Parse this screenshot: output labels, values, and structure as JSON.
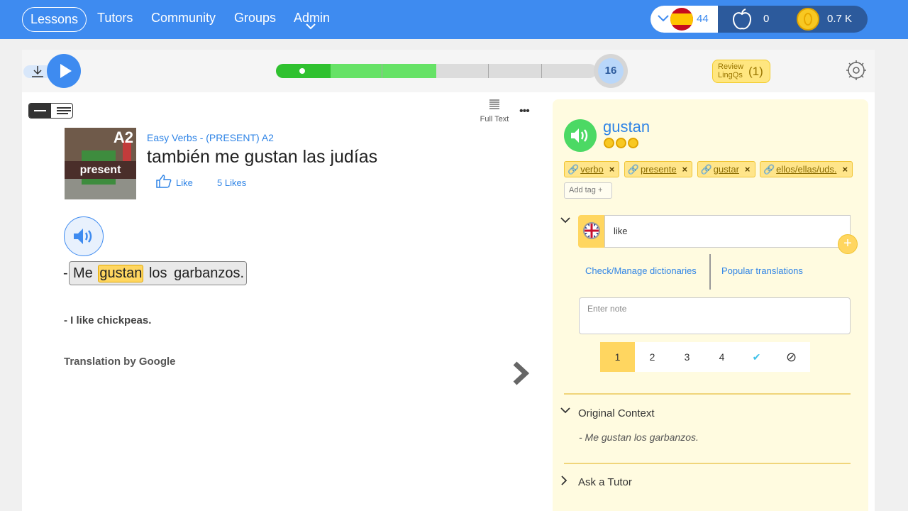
{
  "nav": {
    "items": [
      {
        "label": "Lessons",
        "active": true
      },
      {
        "label": "Tutors"
      },
      {
        "label": "Community"
      },
      {
        "label": "Groups"
      },
      {
        "label": "Admin"
      }
    ]
  },
  "stats": {
    "language_flag": "spain-flag-icon",
    "known_words": "44",
    "streak": "0",
    "coins": "0.7 K"
  },
  "toolbar": {
    "progress": {
      "fraction": 0.5,
      "completed_fraction": 0.17
    },
    "lesson_count": "16",
    "review_label": "Review LingQs",
    "review_count": "(1)"
  },
  "reader": {
    "full_text_label": "Full Text",
    "more_label": "•••",
    "thumbnail": {
      "level": "A2",
      "label": "present"
    },
    "course": "Easy Verbs - (PRESENT) A2",
    "title": "también me gustan las judías",
    "like_label": "Like",
    "likes_count": "5 Likes",
    "sentence_dash": "-",
    "sentence_words": [
      "Me",
      "gustan",
      "los",
      "garbanzos."
    ],
    "translation": "- I like chickpeas.",
    "translation_credit": "Translation by Google"
  },
  "panel": {
    "term": "gustan",
    "tags": [
      "verbo",
      "presente",
      "gustar",
      "ellos/ellas/uds."
    ],
    "add_tag_label": "Add tag +",
    "meaning": "like",
    "add_meaning_label": "+",
    "check_dictionaries": "Check/Manage dictionaries",
    "popular_translations": "Popular translations",
    "note_placeholder": "Enter note",
    "status_options": [
      "1",
      "2",
      "3",
      "4",
      "✔",
      "⊘"
    ],
    "status_selected": "1",
    "context_title": "Original Context",
    "context_text": "- Me gustan los garbanzos.",
    "ask_tutor": "Ask a Tutor"
  },
  "colors": {
    "nav_blue": "#3e8bf0",
    "stats_navy": "#2c5a9c",
    "progress_green": "#2fc12f",
    "highlight_yellow": "#ffd660",
    "panel_bg": "#fffbe0",
    "audio_green": "#4cd964",
    "link_blue": "#2f84e6"
  }
}
